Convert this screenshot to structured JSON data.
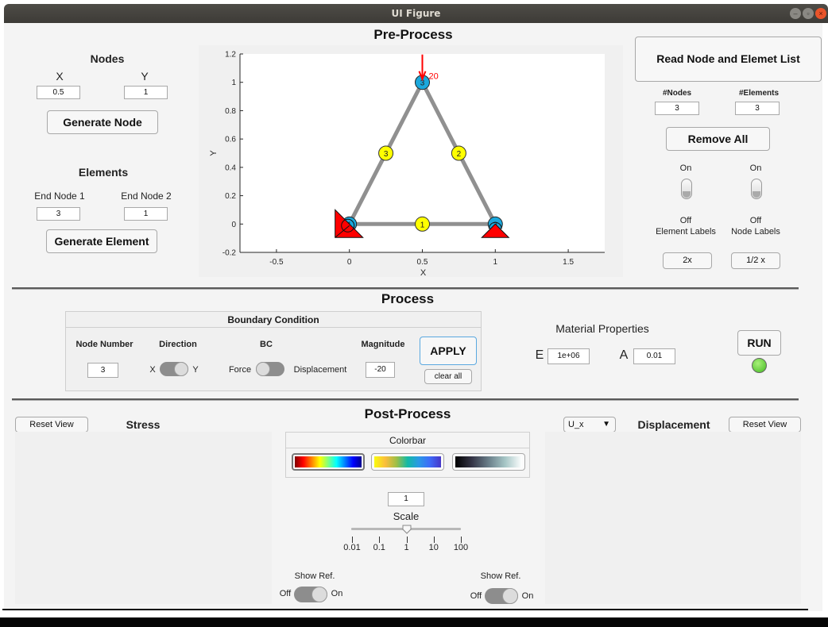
{
  "window": {
    "title": "UI Figure",
    "controls": [
      "minimize",
      "maximize",
      "close"
    ]
  },
  "pre_process": {
    "title": "Pre-Process",
    "nodes": {
      "heading": "Nodes",
      "x_label": "X",
      "y_label": "Y",
      "x_value": "0.5",
      "y_value": "1",
      "generate_button": "Generate Node"
    },
    "elements": {
      "heading": "Elements",
      "end1_label": "End Node 1",
      "end2_label": "End Node 2",
      "end1_value": "3",
      "end2_value": "1",
      "generate_button": "Generate Element"
    },
    "read_button": "Read Node and Elemet List",
    "counts": {
      "nodes_label": "#Nodes",
      "elements_label": "#Elements",
      "nodes_value": "3",
      "elements_value": "3"
    },
    "remove_all_button": "Remove All",
    "label_switches": [
      {
        "on": "On",
        "off": "Off",
        "name": "Element Labels",
        "state": "Off"
      },
      {
        "on": "On",
        "off": "Off",
        "name": "Node Labels",
        "state": "Off"
      }
    ],
    "zoom_in_button": "2x",
    "zoom_out_button": "1/2 x"
  },
  "chart_data": {
    "type": "scatter",
    "title": "",
    "xlabel": "X",
    "ylabel": "Y",
    "xlim": [
      -0.75,
      1.75
    ],
    "ylim": [
      -0.2,
      1.2
    ],
    "xticks": [
      "-0.5",
      "0",
      "0.5",
      "1",
      "1.5"
    ],
    "xtick_values": [
      -0.5,
      0,
      0.5,
      1,
      1.5
    ],
    "yticks": [
      "-0.2",
      "0",
      "0.2",
      "0.4",
      "0.6",
      "0.8",
      "1",
      "1.2"
    ],
    "ytick_values": [
      -0.2,
      0,
      0.2,
      0.4,
      0.6,
      0.8,
      1,
      1.2
    ],
    "nodes": [
      {
        "id": "1",
        "x": 0,
        "y": 0
      },
      {
        "id": "2",
        "x": 1,
        "y": 0
      },
      {
        "id": "3",
        "x": 0.5,
        "y": 1
      }
    ],
    "elements": [
      {
        "id": "1",
        "from": 1,
        "to": 2
      },
      {
        "id": "2",
        "from": 2,
        "to": 3
      },
      {
        "id": "3",
        "from": 3,
        "to": 1
      }
    ],
    "supports": [
      {
        "node": 1,
        "type": "fixed"
      },
      {
        "node": 2,
        "type": "roller"
      }
    ],
    "loads": [
      {
        "node": 3,
        "direction": "Y",
        "magnitude": -20,
        "label": "20"
      }
    ],
    "colors": {
      "node": "#1ba8dc",
      "element_label": "#ffff00",
      "element_line": "#909090",
      "support": "#ff0000",
      "load": "#ff0000"
    }
  },
  "process": {
    "title": "Process",
    "bc_panel_title": "Boundary Condition",
    "node_number_label": "Node Number",
    "node_number_value": "3",
    "direction_label": "Direction",
    "direction_left": "X",
    "direction_right": "Y",
    "direction_state": "Y",
    "bc_label": "BC",
    "bc_left": "Force",
    "bc_right": "Displacement",
    "bc_state": "Force",
    "magnitude_label": "Magnitude",
    "magnitude_value": "-20",
    "apply_button": "APPLY",
    "clear_button": "clear all",
    "material_title": "Material Properties",
    "e_label": "E",
    "e_value": "1e+06",
    "a_label": "A",
    "a_value": "0.01",
    "run_button": "RUN",
    "status_lamp_color": "#44bb22"
  },
  "post_process": {
    "title": "Post-Process",
    "stress_title": "Stress",
    "displacement_title": "Displacement",
    "reset_view_left": "Reset View",
    "reset_view_right": "Reset View",
    "component_select": "U_x",
    "colorbar_title": "Colorbar",
    "colormaps": [
      "jet",
      "parula",
      "bone"
    ],
    "selected_colormap": "jet",
    "scale_value": "1",
    "scale_label": "Scale",
    "scale_ticks": [
      "0.01",
      "0.1",
      "1",
      "10",
      "100"
    ],
    "scale_slider_value": 1,
    "show_ref_left": {
      "label": "Show Ref.",
      "off": "Off",
      "on": "On",
      "state": "On"
    },
    "show_ref_right": {
      "label": "Show Ref.",
      "off": "Off",
      "on": "On",
      "state": "On"
    }
  }
}
